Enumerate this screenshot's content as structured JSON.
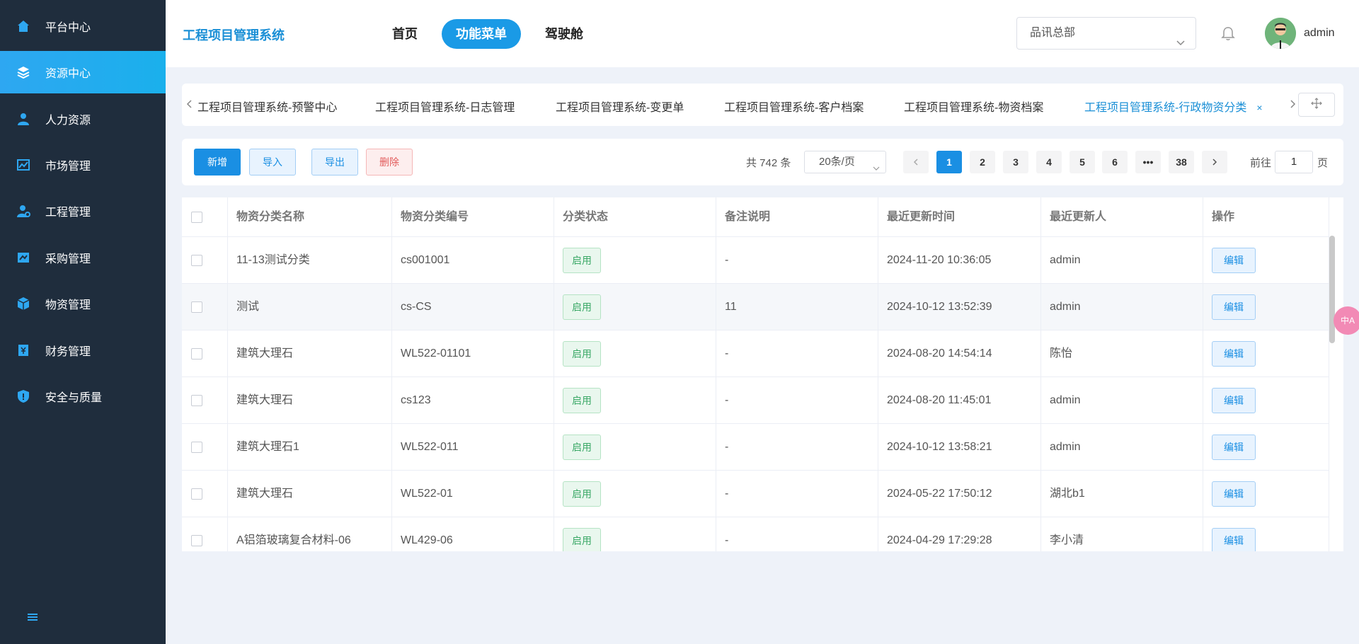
{
  "sidebar": {
    "items": [
      {
        "label": "平台中心",
        "icon": "home-icon"
      },
      {
        "label": "资源中心",
        "icon": "layers-icon"
      },
      {
        "label": "人力资源",
        "icon": "user-icon"
      },
      {
        "label": "市场管理",
        "icon": "chart-icon"
      },
      {
        "label": "工程管理",
        "icon": "engineer-icon"
      },
      {
        "label": "采购管理",
        "icon": "purchase-icon"
      },
      {
        "label": "物资管理",
        "icon": "box-icon"
      },
      {
        "label": "财务管理",
        "icon": "finance-icon"
      },
      {
        "label": "安全与质量",
        "icon": "shield-icon"
      }
    ],
    "active_index": 1
  },
  "header": {
    "title": "工程项目管理系统",
    "nav": [
      "首页",
      "功能菜单",
      "驾驶舱"
    ],
    "active_nav": "功能菜单",
    "org_select": "品讯总部",
    "username": "admin"
  },
  "tabs": [
    {
      "label": "工程项目管理系统-预警中心"
    },
    {
      "label": "工程项目管理系统-日志管理"
    },
    {
      "label": "工程项目管理系统-变更单"
    },
    {
      "label": "工程项目管理系统-客户档案"
    },
    {
      "label": "工程项目管理系统-物资档案"
    },
    {
      "label": "工程项目管理系统-行政物资分类",
      "close": "×"
    }
  ],
  "toolbar": {
    "add": "新增",
    "import": "导入",
    "export": "导出",
    "delete": "删除",
    "total": "共 742 条",
    "page_size": "20条/页",
    "pages": [
      "1",
      "2",
      "3",
      "4",
      "5",
      "6",
      "•••",
      "38"
    ],
    "goto_prefix": "前往",
    "goto_value": "1",
    "goto_suffix": "页"
  },
  "table": {
    "columns": [
      "物资分类名称",
      "物资分类编号",
      "分类状态",
      "备注说明",
      "最近更新时间",
      "最近更新人",
      "操作"
    ],
    "rows": [
      {
        "name": "11-13测试分类",
        "code": "cs001001",
        "status": "启用",
        "note": "-",
        "updated": "2024-11-20 10:36:05",
        "by": "admin",
        "action": "编辑"
      },
      {
        "name": "测试",
        "code": "cs-CS",
        "status": "启用",
        "note": "11",
        "updated": "2024-10-12 13:52:39",
        "by": "admin",
        "action": "编辑"
      },
      {
        "name": "建筑大理石",
        "code": "WL522-01101",
        "status": "启用",
        "note": "-",
        "updated": "2024-08-20 14:54:14",
        "by": "陈怡",
        "action": "编辑"
      },
      {
        "name": "建筑大理石",
        "code": "cs123",
        "status": "启用",
        "note": "-",
        "updated": "2024-08-20 11:45:01",
        "by": "admin",
        "action": "编辑"
      },
      {
        "name": "建筑大理石1",
        "code": "WL522-011",
        "status": "启用",
        "note": "-",
        "updated": "2024-10-12 13:58:21",
        "by": "admin",
        "action": "编辑"
      },
      {
        "name": "建筑大理石",
        "code": "WL522-01",
        "status": "启用",
        "note": "-",
        "updated": "2024-05-22 17:50:12",
        "by": "湖北b1",
        "action": "编辑"
      },
      {
        "name": "A铝箔玻璃复合材料-06",
        "code": "WL429-06",
        "status": "启用",
        "note": "-",
        "updated": "2024-04-29 17:29:28",
        "by": "李小清",
        "action": "编辑"
      }
    ]
  },
  "float_widget": "中A",
  "colors": {
    "sidebar_bg": "#1f2d3d",
    "accent": "#1a8fe3",
    "active_tab": "#1a8fd6",
    "status_green": "#3aa866",
    "danger": "#e25b5b"
  }
}
